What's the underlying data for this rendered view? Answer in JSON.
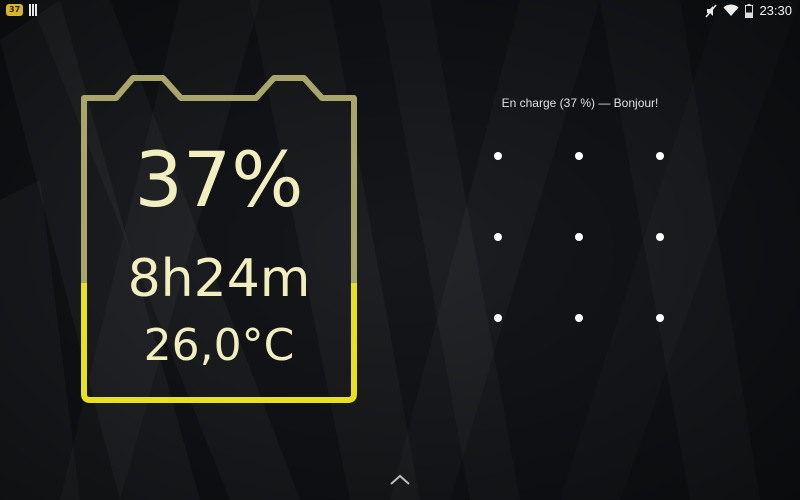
{
  "status_bar": {
    "notification_badge": "37",
    "time": "23:30",
    "icons": [
      "barcode-icon",
      "mute-icon",
      "wifi-icon",
      "battery-icon"
    ]
  },
  "battery_widget": {
    "percent_text": "37%",
    "time_remaining": "8h24m",
    "temperature": "26,0°C",
    "charge_level": 0.37,
    "accent_color": "#e8e020",
    "outline_color": "#a8a66a"
  },
  "lock_screen": {
    "charging_message": "En charge (37 %) — Bonjour!",
    "pattern_grid": "3x3"
  }
}
